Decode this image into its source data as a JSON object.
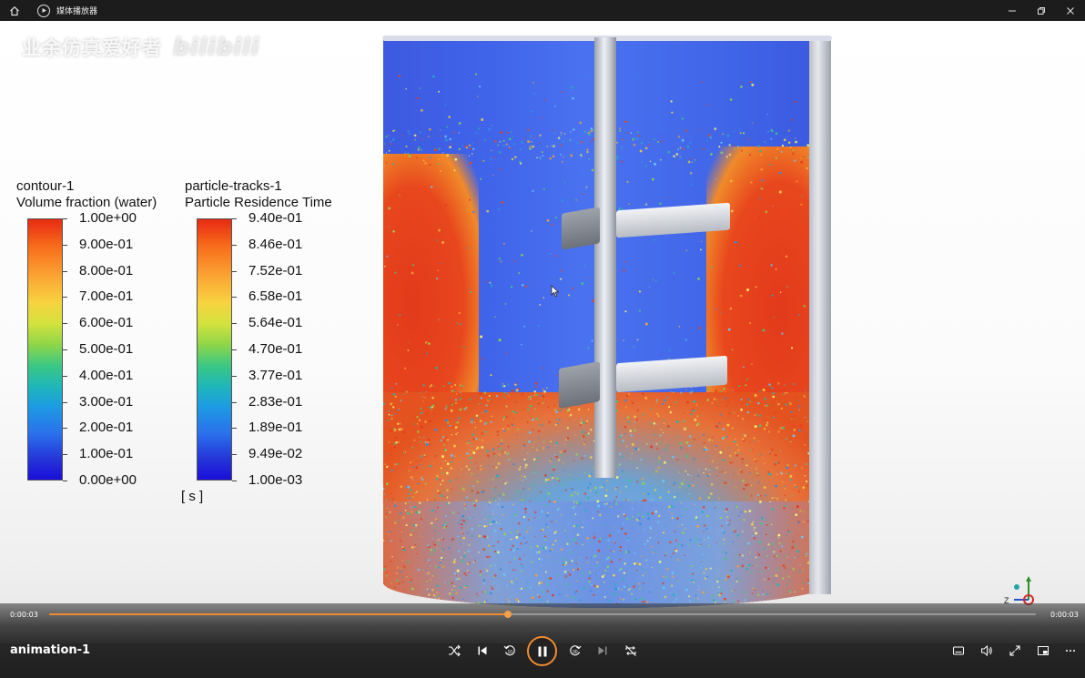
{
  "titlebar": {
    "title": "媒体播放器"
  },
  "watermark": {
    "channel": "业余仿真爱好者",
    "site": "bilibili"
  },
  "legend_contour": {
    "name": "contour-1",
    "variable": "Volume fraction (water)",
    "labels": [
      "1.00e+00",
      "9.00e-01",
      "8.00e-01",
      "7.00e-01",
      "6.00e-01",
      "5.00e-01",
      "4.00e-01",
      "3.00e-01",
      "2.00e-01",
      "1.00e-01",
      "0.00e+00"
    ]
  },
  "legend_particles": {
    "name": "particle-tracks-1",
    "variable": "Particle Residence Time",
    "labels": [
      "9.40e-01",
      "8.46e-01",
      "7.52e-01",
      "6.58e-01",
      "5.64e-01",
      "4.70e-01",
      "3.77e-01",
      "2.83e-01",
      "1.89e-01",
      "9.49e-02",
      "1.00e-03"
    ],
    "unit": "[ s ]"
  },
  "axes": {
    "z": "Z"
  },
  "player": {
    "current_time": "0:00:03",
    "total_time": "0:00:03",
    "progress": 0.465,
    "media_title": "animation-1"
  },
  "colors": {
    "accent": "#f08b30",
    "titlebar": "#1c1c1c"
  }
}
